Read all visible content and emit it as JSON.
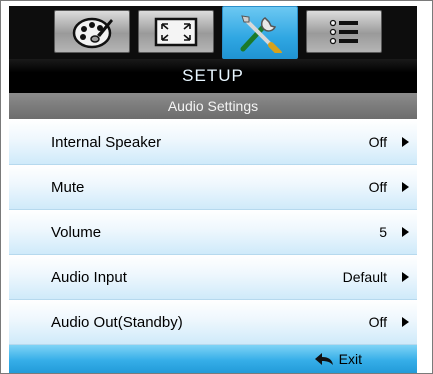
{
  "tabs": [
    {
      "icon": "palette-icon",
      "active": false
    },
    {
      "icon": "fullscreen-icon",
      "active": false
    },
    {
      "icon": "tools-icon",
      "active": true
    },
    {
      "icon": "list-icon",
      "active": false
    }
  ],
  "header": {
    "title": "SETUP",
    "subtitle": "Audio Settings"
  },
  "rows": [
    {
      "label": "Internal Speaker",
      "value": "Off"
    },
    {
      "label": "Mute",
      "value": "Off"
    },
    {
      "label": "Volume",
      "value": "5"
    },
    {
      "label": "Audio Input",
      "value": "Default"
    },
    {
      "label": "Audio Out(Standby)",
      "value": "Off"
    }
  ],
  "footer": {
    "exit_label": "Exit",
    "exit_icon": "back-arrow-icon"
  },
  "colors": {
    "accent": "#2fa6e2",
    "header_bg": "#000000",
    "subheader_bg": "#7a7a7a"
  }
}
